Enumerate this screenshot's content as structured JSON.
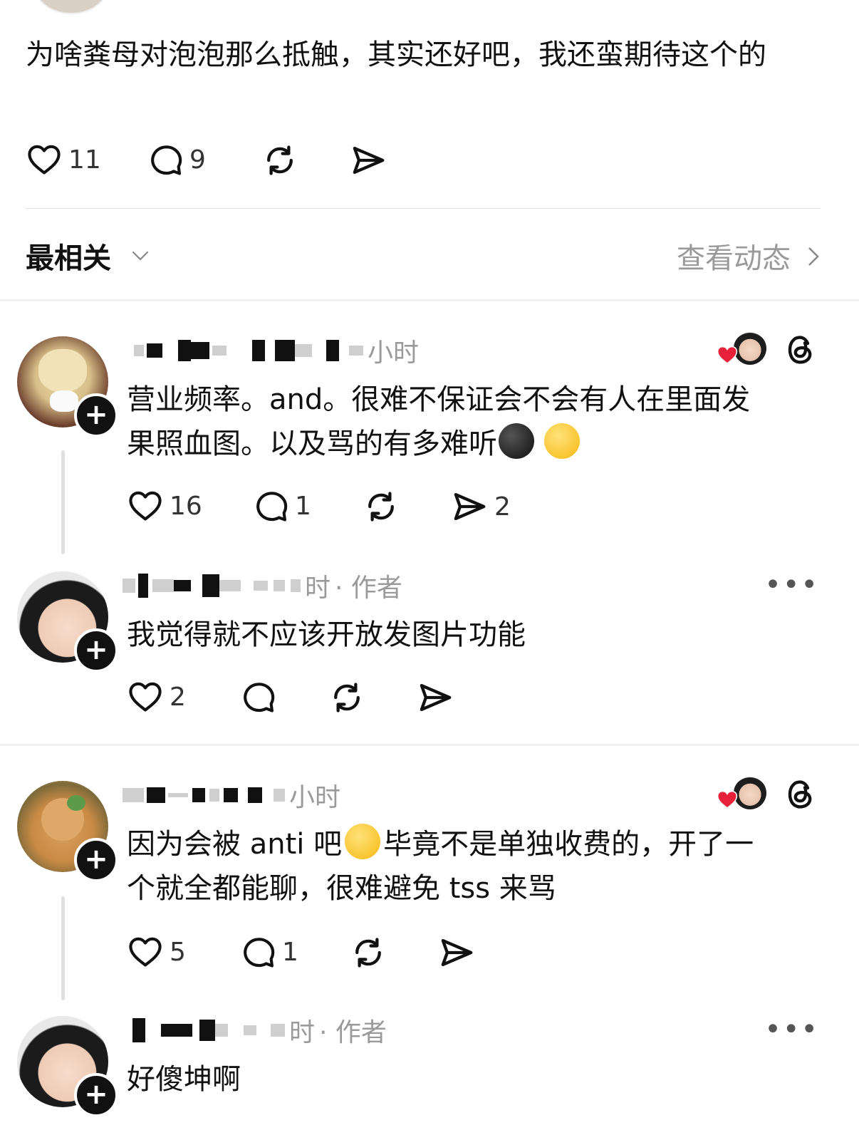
{
  "post": {
    "text": "为啥粪母对泡泡那么抵触，其实还好吧，我还蛮期待这个的",
    "likes": "11",
    "comments": "9"
  },
  "sort": {
    "label": "最相关",
    "view_activity": "查看动态"
  },
  "comments": [
    {
      "time": "小时",
      "text_line1": "营业频率。and。很难不保证会不会有人在里面发",
      "text_line2": "果照血图。以及骂的有多难听",
      "likes": "16",
      "replies": "1",
      "shares": "2"
    },
    {
      "time": "时",
      "author_tag": "· 作者",
      "text": "我觉得就不应该开放发图片功能",
      "likes": "2"
    },
    {
      "time": "小时",
      "text_line1a": "因为会被 anti 吧",
      "text_line1b": "毕竟不是单独收费的，开了一",
      "text_line2": "个就全都能聊，很难避免 tss 来骂",
      "likes": "5",
      "replies": "1"
    },
    {
      "time": "时",
      "author_tag": "· 作者",
      "text": "好傻坤啊"
    }
  ],
  "colors": {
    "heart_red": "#e8213b",
    "muted": "#9a9a9a",
    "text": "#111111"
  },
  "icons": [
    "heart-icon",
    "comment-icon",
    "repost-icon",
    "share-icon",
    "chevron-down-icon",
    "chevron-right-icon",
    "threads-icon",
    "more-icon",
    "plus-icon"
  ]
}
